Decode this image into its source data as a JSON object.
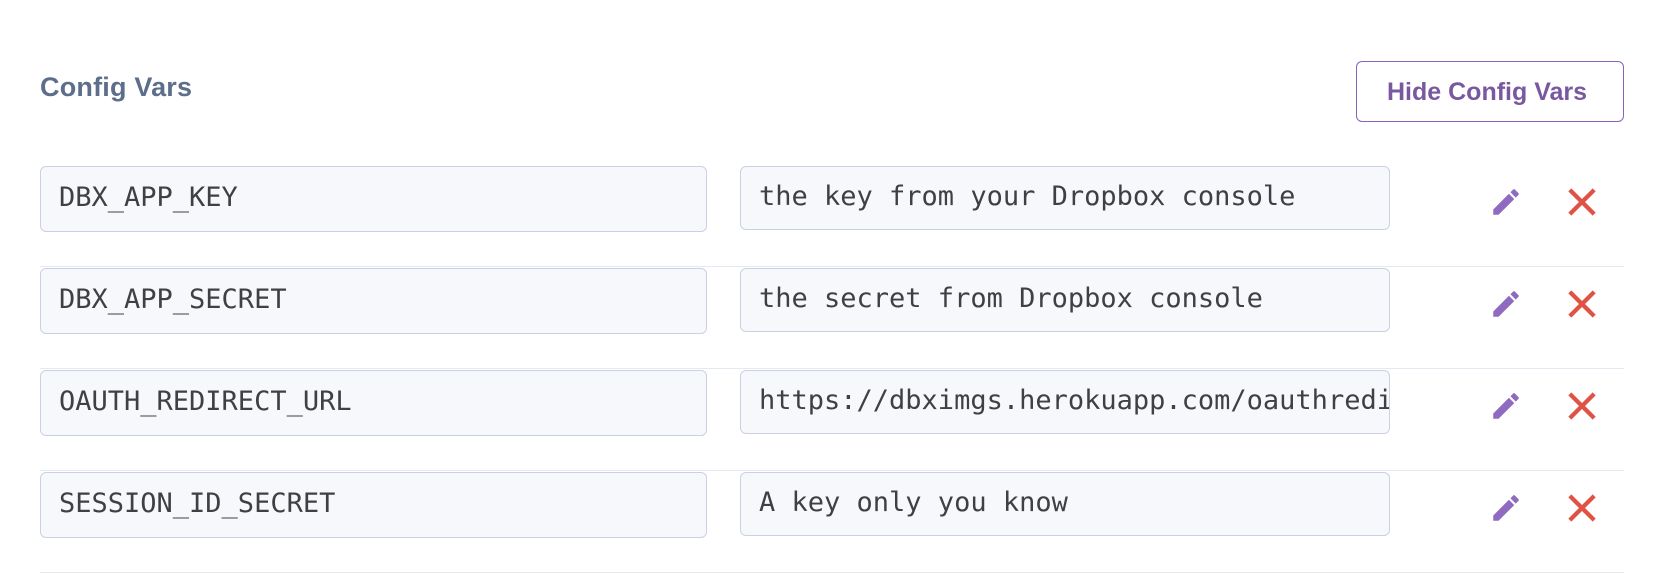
{
  "header": {
    "title": "Config Vars",
    "hide_button_label": "Hide Config Vars"
  },
  "config_vars": [
    {
      "key": "DBX_APP_KEY",
      "value": "the key from your Dropbox console"
    },
    {
      "key": "DBX_APP_SECRET",
      "value": "the secret from Dropbox console"
    },
    {
      "key": "OAUTH_REDIRECT_URL",
      "value": "https://dbximgs.herokuapp.com/oauthredirect"
    },
    {
      "key": "SESSION_ID_SECRET",
      "value": "A key only you know"
    }
  ],
  "icons": {
    "edit": "pencil-icon",
    "delete": "close-icon"
  },
  "colors": {
    "accent_purple": "#79589f",
    "delete_red": "#e05243",
    "title_slate": "#5d6e8a"
  }
}
